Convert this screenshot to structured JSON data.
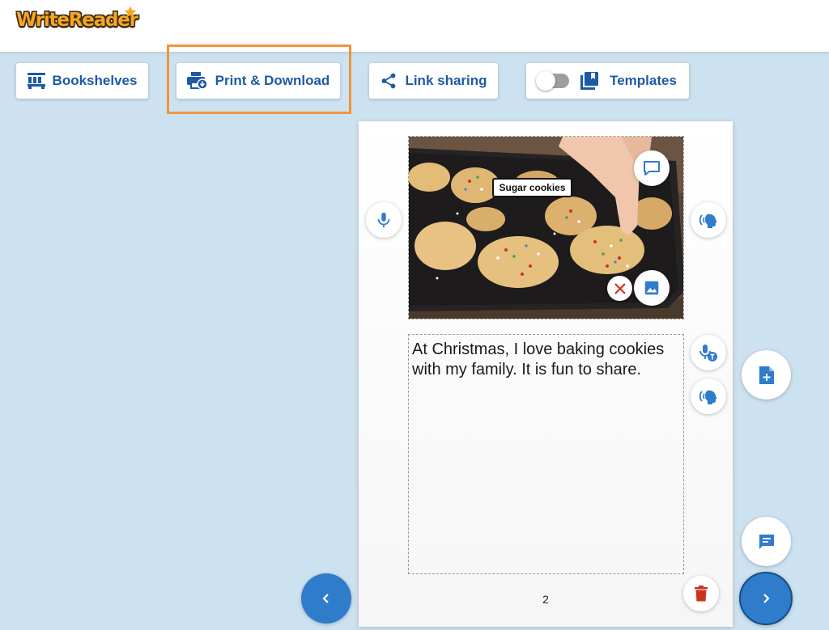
{
  "header": {
    "logo_text": "WriteReader",
    "logo_color": "#f5a623"
  },
  "toolbar": {
    "bookshelves_label": "Bookshelves",
    "bookshelves_icon": "bookshelves-icon",
    "print_label": "Print & Download",
    "print_icon": "printer-download-icon",
    "link_label": "Link sharing",
    "link_icon": "share-icon",
    "templates_label": "Templates",
    "templates_icon": "templates-icon",
    "templates_toggle_on": false,
    "accent_color": "#1d5aa3",
    "highlight_color": "#f0953a"
  },
  "page": {
    "image_caption": "Sugar cookies",
    "text": "At Christmas, I love baking cookies with my family. It is fun to share.",
    "page_number": "2"
  },
  "colors": {
    "background": "#cde2f0",
    "button_blue": "#2f7ccb",
    "icon_blue": "#2f7ccb",
    "delete_red": "#c9341c"
  }
}
